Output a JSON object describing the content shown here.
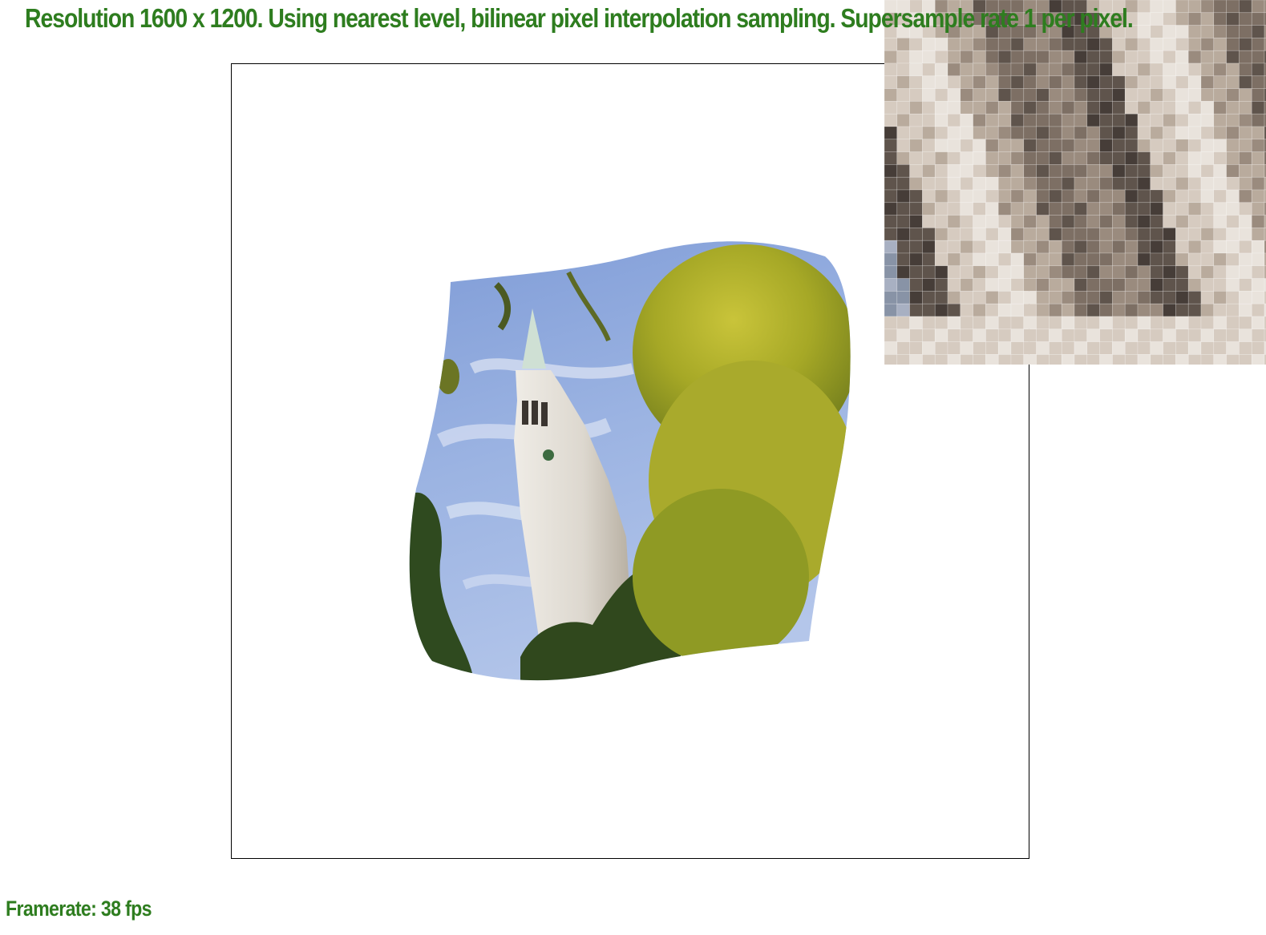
{
  "status": {
    "text": "Resolution 1600 x 1200. Using nearest level, bilinear pixel interpolation sampling. Supersample rate 1 per pixel.",
    "color": "#2e7d1f"
  },
  "framerate": {
    "text": "Framerate: 38 fps",
    "color": "#2e7d1f"
  },
  "zoom_inset": {
    "palette": [
      "#e9e3dc",
      "#d6cbc0",
      "#b9ab9d",
      "#9a8b7e",
      "#7d6f64",
      "#5f544c",
      "#463d38",
      "#8893a6",
      "#a8b0c2",
      "#6e6658"
    ]
  }
}
